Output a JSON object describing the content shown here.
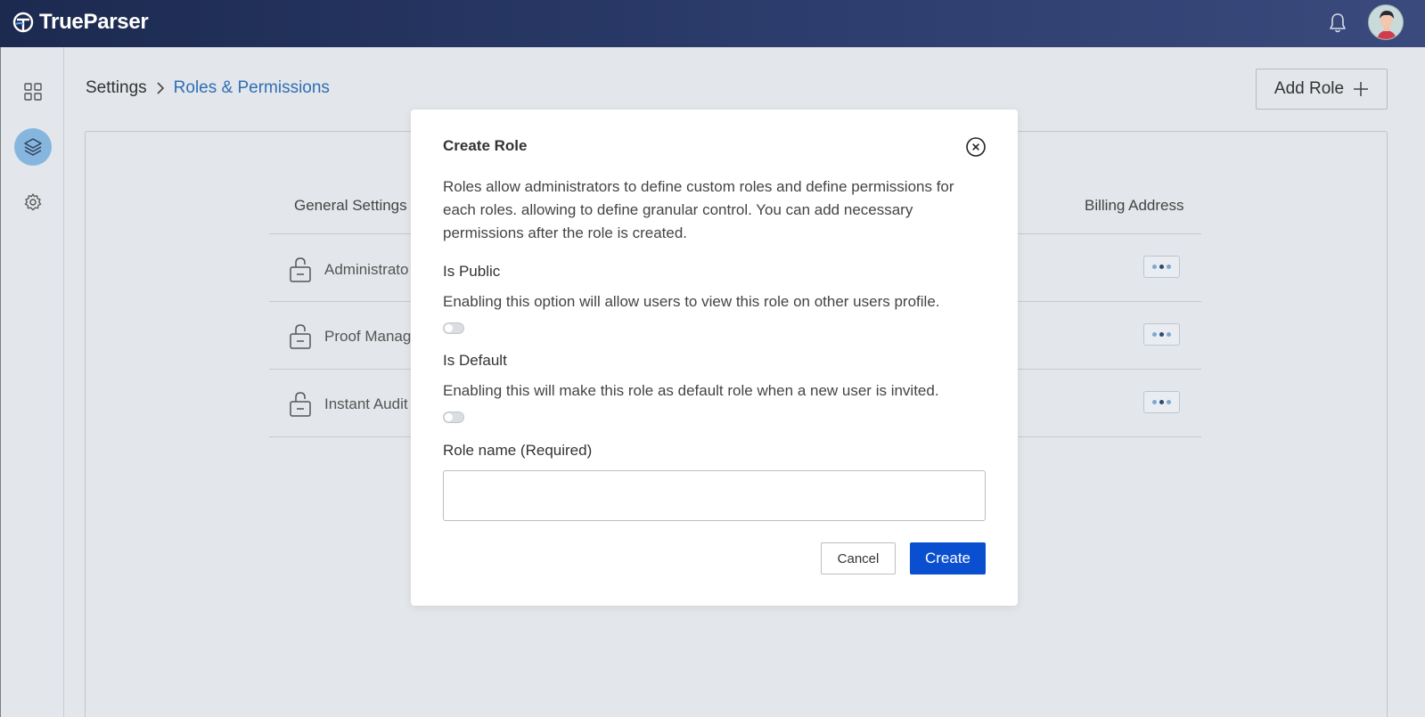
{
  "app": {
    "name": "TrueParser",
    "brand_color": "#1c2a50",
    "accent_color": "#2f6eb5"
  },
  "header": {
    "logo_icon": "trueparser-logo-icon",
    "notification_icon": "bell-icon",
    "avatar_icon": "user-avatar"
  },
  "sidebar": {
    "items": [
      {
        "icon": "grid-icon",
        "active": false
      },
      {
        "icon": "layers-icon",
        "active": true
      },
      {
        "icon": "gear-icon",
        "active": false
      }
    ]
  },
  "page": {
    "breadcrumb_root": "Settings",
    "breadcrumb_current": "Roles & Permissions",
    "add_role_label": "Add Role"
  },
  "table": {
    "columns": {
      "general": "General Settings",
      "billing": "Billing Address"
    },
    "rows": [
      {
        "label": "Administrato"
      },
      {
        "label": "Proof Manag"
      },
      {
        "label": "Instant Audit"
      }
    ]
  },
  "modal": {
    "title": "Create Role",
    "description": "Roles  allow administrators to define custom roles and define permissions for each roles. allowing to define granular control. You can add necessary permissions after the role is created.",
    "is_public_title": "Is Public",
    "is_public_desc": "Enabling this option will allow users to view this role on other users profile.",
    "is_public_on": false,
    "is_default_title": "Is Default",
    "is_default_desc": "Enabling this will make this role as default role when a new user is invited.",
    "is_default_on": false,
    "role_name_label": "Role name (Required)",
    "role_name_value": "",
    "role_name_placeholder": "",
    "cancel_label": "Cancel",
    "create_label": "Create",
    "create_color": "#0a4fcf"
  }
}
